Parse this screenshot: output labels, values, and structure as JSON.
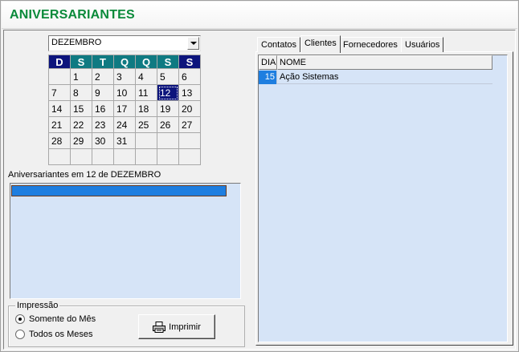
{
  "window": {
    "title": "ANIVERSARIANTES"
  },
  "month_select": {
    "value": "DEZEMBRO"
  },
  "calendar": {
    "weekdays": [
      "D",
      "S",
      "T",
      "Q",
      "Q",
      "S",
      "S"
    ],
    "weeks": [
      [
        "",
        "1",
        "2",
        "3",
        "4",
        "5",
        "6"
      ],
      [
        "7",
        "8",
        "9",
        "10",
        "11",
        "12",
        "13"
      ],
      [
        "14",
        "15",
        "16",
        "17",
        "18",
        "19",
        "20"
      ],
      [
        "21",
        "22",
        "23",
        "24",
        "25",
        "26",
        "27"
      ],
      [
        "28",
        "29",
        "30",
        "31",
        "",
        "",
        ""
      ],
      [
        "",
        "",
        "",
        "",
        "",
        "",
        ""
      ]
    ],
    "selected_day": "12",
    "colors": {
      "header_dark": "#0c147c",
      "header_teal": "#0f7a82"
    }
  },
  "birthday_list": {
    "label": "Aniversariantes em 12 de DEZEMBRO"
  },
  "print_group": {
    "legend": "Impressão",
    "options": [
      {
        "label": "Somente do Mês",
        "checked": true
      },
      {
        "label": "Todos os Meses",
        "checked": false
      }
    ],
    "print_button": "Imprimir"
  },
  "tabs": [
    {
      "label": "Contatos",
      "active": false
    },
    {
      "label": "Clientes",
      "active": true
    },
    {
      "label": "Fornecedores",
      "active": false
    },
    {
      "label": "Usuários",
      "active": false
    }
  ],
  "grid": {
    "columns": [
      "DIA",
      "NOME"
    ],
    "rows": [
      {
        "dia": "15",
        "nome": "Ação Sistemas"
      }
    ]
  },
  "colors": {
    "title": "#0a8a3a",
    "list_bg": "#d6e4f7",
    "selection": "#1e7ee0"
  }
}
